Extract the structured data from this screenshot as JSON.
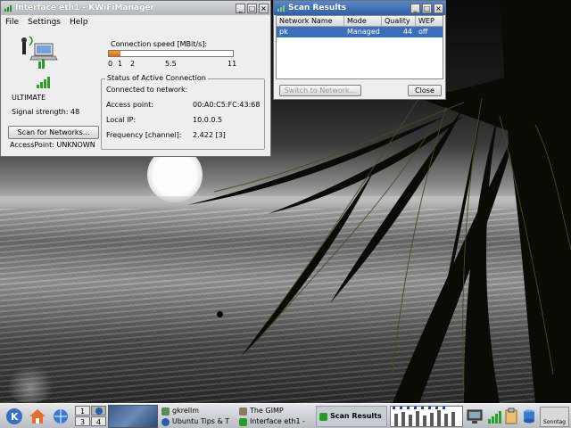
{
  "kwifi": {
    "title": "Interface eth1 - KWiFiManager",
    "menu": [
      "File",
      "Settings",
      "Help"
    ],
    "signal_label": "ULTIMATE",
    "signal_strength": "Signal strength: 48",
    "speed_label": "Connection speed [MBit/s]:",
    "speed_ticks": [
      "0",
      "1",
      "2",
      "5.5",
      "11"
    ],
    "speed_fill_fraction": 0.09,
    "status_title": "Status of Active Connection",
    "connected_label": "Connected to network:",
    "access_point_label": "Access point:",
    "access_point_value": "00:A0:C5:FC:43:68",
    "local_ip_label": "Local IP:",
    "local_ip_value": "10.0.0.5",
    "frequency_label": "Frequency [channel]:",
    "frequency_value": "2.422 [3]",
    "scan_button": "Scan for Networks...",
    "access_point_status": "AccessPoint: UNKNOWN"
  },
  "scan": {
    "title": "Scan Results",
    "columns": [
      "Network Name",
      "Mode",
      "Quality",
      "WEP"
    ],
    "rows": [
      {
        "name": "pk",
        "mode": "Managed",
        "quality": "44",
        "wep": "off"
      }
    ],
    "switch_button": "Switch to Network...",
    "close_button": "Close"
  },
  "taskbar": {
    "pager": [
      "1",
      "2",
      "3",
      "4"
    ],
    "tasks": [
      "gkrellm",
      "The GIMP",
      "Ubuntu Tips & T",
      "Interface eth1 -",
      "Scan Results"
    ],
    "clock": "Sonntag"
  },
  "colors": {
    "title_active": "#2f5fa6",
    "selection": "#3d6fb8",
    "speed_fill": "#e07b1a"
  }
}
